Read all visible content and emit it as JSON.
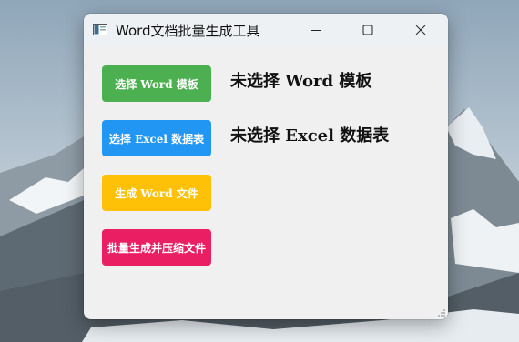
{
  "window": {
    "title": "Word文档批量生成工具",
    "controls": {
      "minimize_icon": "minimize-icon",
      "maximize_icon": "maximize-icon",
      "close_icon": "close-icon"
    }
  },
  "buttons": {
    "select_word": "选择 Word 模板",
    "select_excel": "选择 Excel 数据表",
    "generate_word": "生成 Word 文件",
    "batch_zip": "批量生成并压缩文件"
  },
  "status": {
    "word_template": "未选择 Word 模板",
    "excel_data": "未选择 Excel 数据表"
  },
  "colors": {
    "green": "#4caf50",
    "blue": "#2196f3",
    "amber": "#ffc107",
    "pink": "#e91e63"
  }
}
